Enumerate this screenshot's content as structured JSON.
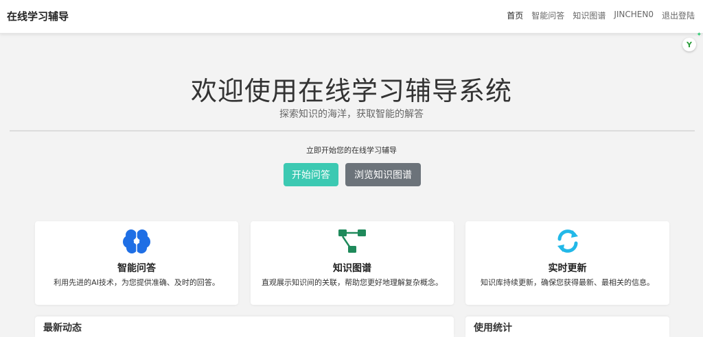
{
  "navbar": {
    "brand": "在线学习辅导",
    "links": [
      "首页",
      "智能问答",
      "知识图谱",
      "JINCHEN0",
      "退出登陆"
    ]
  },
  "hero": {
    "title": "欢迎使用在线学习辅导系统",
    "subtitle": "探索知识的海洋，获取智能的解答",
    "cta_text": "立即开始您的在线学习辅导",
    "primary_button": "开始问答",
    "secondary_button": "浏览知识图谱"
  },
  "features": [
    {
      "title": "智能问答",
      "desc": "利用先进的AI技术，为您提供准确、及时的回答。",
      "icon": "brain-icon",
      "color": "#1f6fe5"
    },
    {
      "title": "知识图谱",
      "desc": "直观展示知识间的关联，帮助您更好地理解复杂概念。",
      "icon": "project-diagram-icon",
      "color": "#1f8a5b"
    },
    {
      "title": "实时更新",
      "desc": "知识库持续更新，确保您获得最新、最相关的信息。",
      "icon": "sync-icon",
      "color": "#22b8e8"
    }
  ],
  "bottom_sections": {
    "left_title": "最新动态",
    "right_title": "使用统计"
  },
  "extension": {
    "label": "Y"
  },
  "colors": {
    "primary": "#3cc9b2",
    "secondary": "#6c737a",
    "background": "#f3f3f3"
  }
}
